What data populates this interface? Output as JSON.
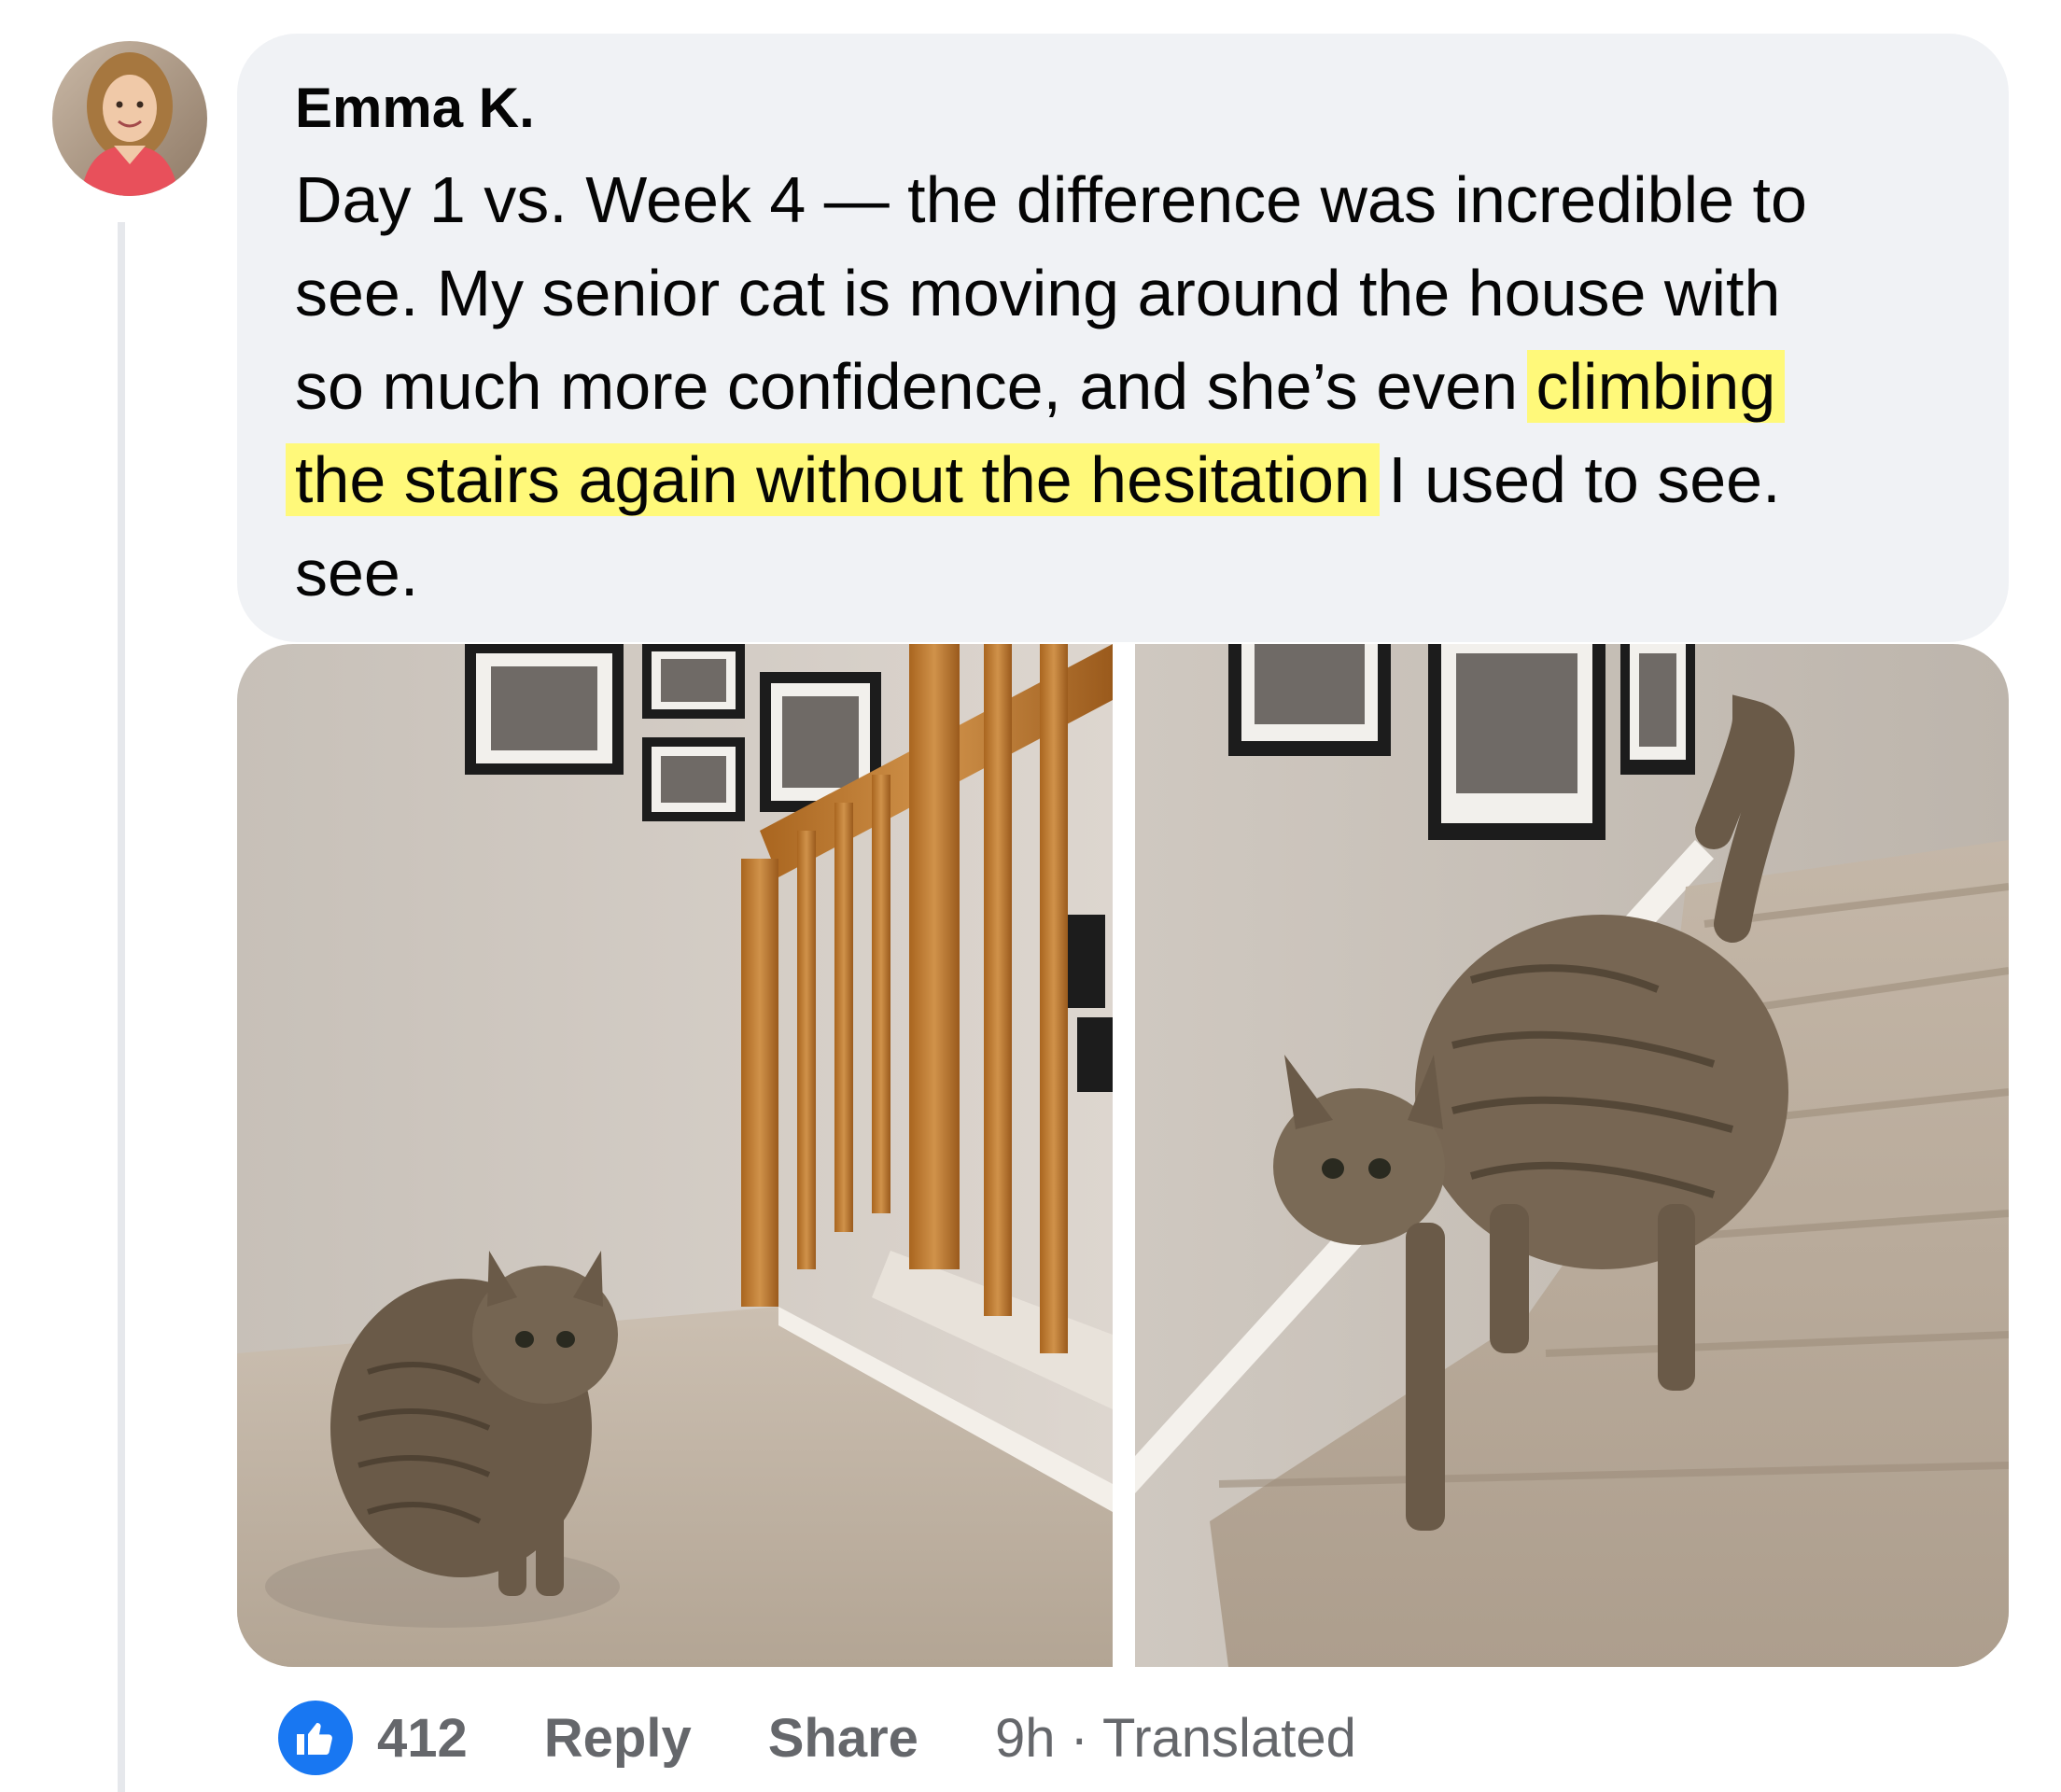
{
  "comment": {
    "author": "Emma K.",
    "text_lines": [
      {
        "before": "Day 1 vs. Week 4 — the difference was incredible to",
        "highlight": "",
        "after": ""
      },
      {
        "before": "see. My senior cat is moving around the house with",
        "highlight": "",
        "after": ""
      },
      {
        "before": "so much more confidence, and she’s even ",
        "highlight": "climbing",
        "after": ""
      },
      {
        "before": "",
        "highlight": "the stairs again without the hesitation",
        "after": " I used to see."
      },
      {
        "before": "see.",
        "highlight": "",
        "after": ""
      }
    ],
    "highlight_color": "#fff97a",
    "bubble_color": "#f0f2f5"
  },
  "photos": {
    "left_alt": "Cat sitting at the top of carpeted stairs next to a wooden banister",
    "right_alt": "Cat walking down carpeted stairs with tail raised"
  },
  "actions": {
    "like_icon": "thumbs-up-icon",
    "like_count": "412",
    "reply_label": "Reply",
    "share_label": "Share",
    "time": "9h",
    "separator": " · ",
    "translated": "Translated",
    "like_color": "#1877f2",
    "text_color": "#65676b"
  }
}
